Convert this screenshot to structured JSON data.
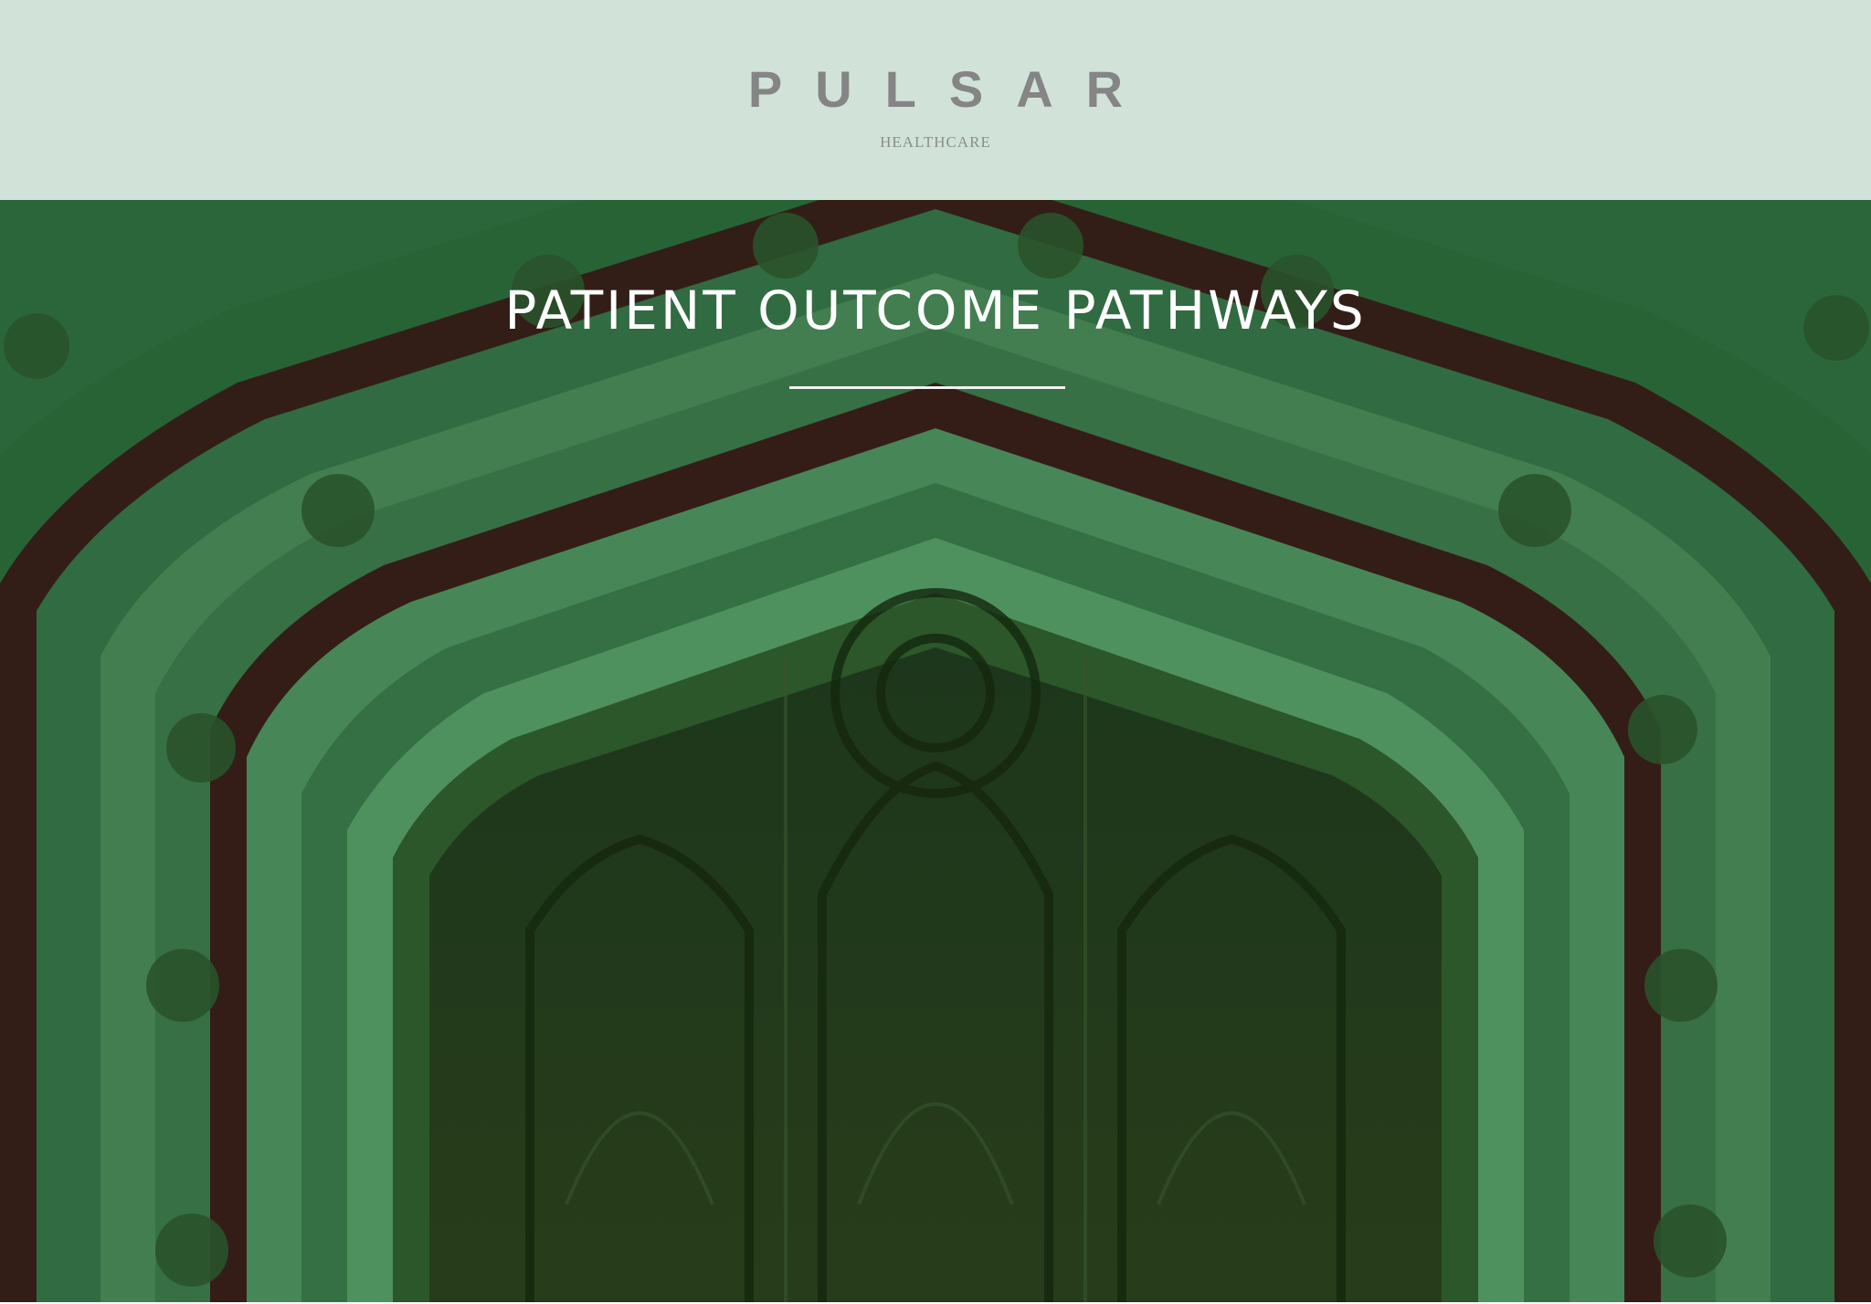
{
  "header": {
    "brand": "PULSAR",
    "subbrand": "HEALTHCARE",
    "background_color": "#d1e3d9",
    "brand_color": "#858585"
  },
  "hero": {
    "title": "PATIENT OUTCOME PATHWAYS",
    "image_description_color": "#2d6a3d",
    "title_color": "#ffffff"
  }
}
